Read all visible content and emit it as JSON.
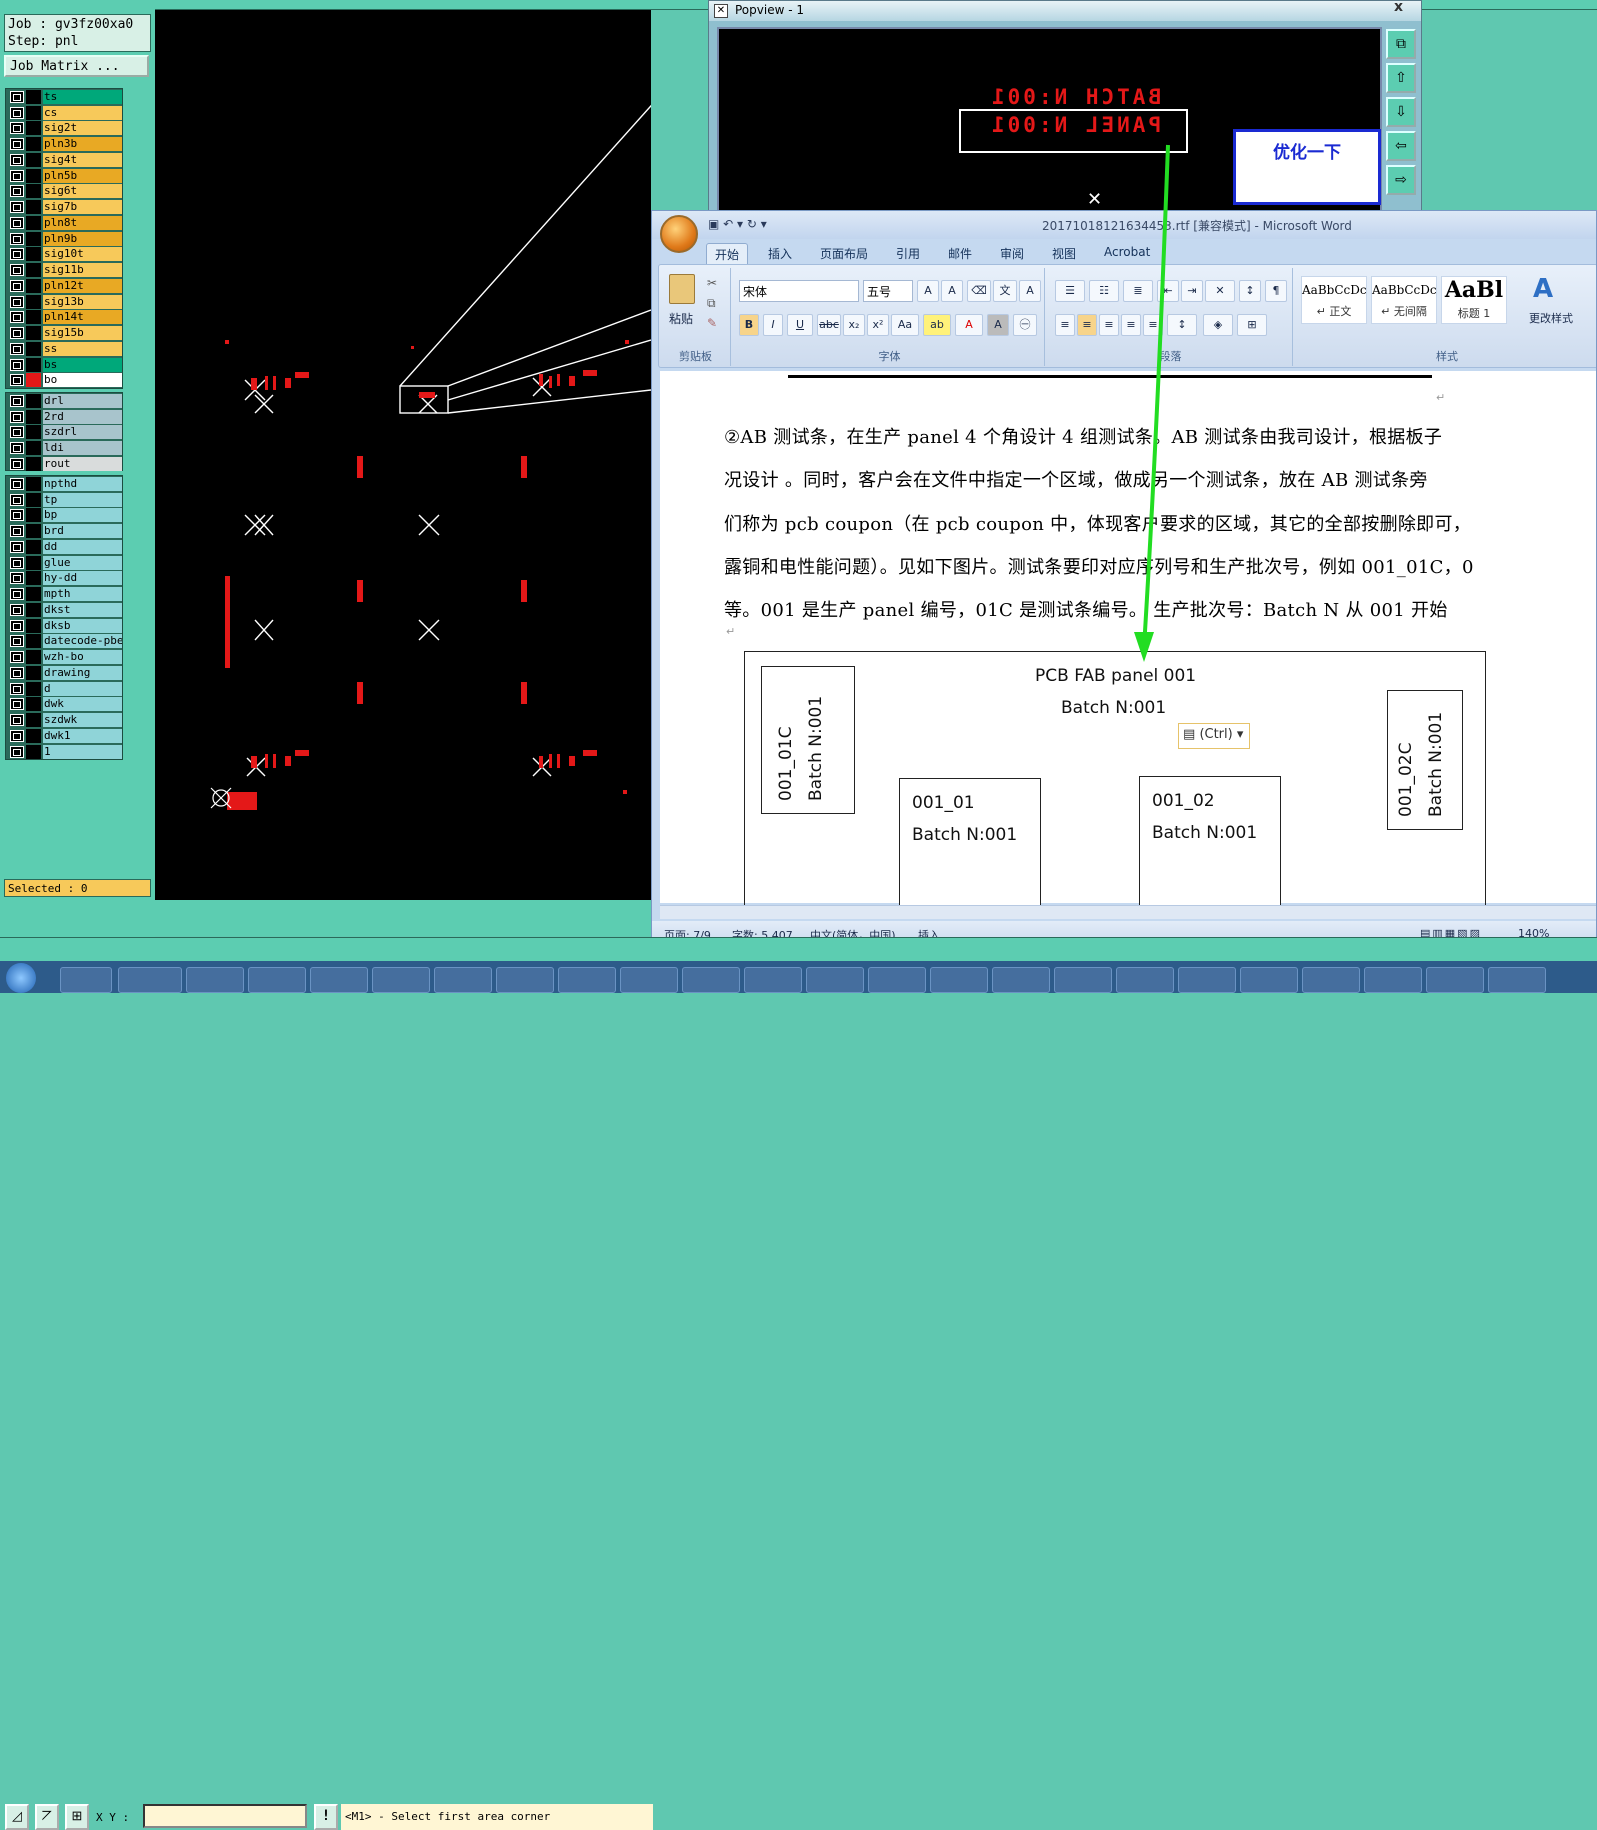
{
  "cam": {
    "job_line": "Job : gv3fz00xa0",
    "step_line": "Step: pnl",
    "job_matrix_button": "Job Matrix ...",
    "layers_group1": [
      {
        "name": "ts",
        "color": "#00a87a"
      },
      {
        "name": "cs",
        "color": "#f7c95a"
      },
      {
        "name": "sig2t",
        "color": "#f7c95a"
      },
      {
        "name": "pln3b",
        "color": "#e8a924"
      },
      {
        "name": "sig4t",
        "color": "#f7c95a"
      },
      {
        "name": "pln5b",
        "color": "#e8a924"
      },
      {
        "name": "sig6t",
        "color": "#f7c95a"
      },
      {
        "name": "sig7b",
        "color": "#f7c95a"
      },
      {
        "name": "pln8t",
        "color": "#e8a924"
      },
      {
        "name": "pln9b",
        "color": "#e8a924"
      },
      {
        "name": "sig10t",
        "color": "#f7c95a"
      },
      {
        "name": "sig11b",
        "color": "#f7c95a"
      },
      {
        "name": "pln12t",
        "color": "#e8a924"
      },
      {
        "name": "sig13b",
        "color": "#f7c95a"
      },
      {
        "name": "pln14t",
        "color": "#e8a924"
      },
      {
        "name": "sig15b",
        "color": "#f7c95a"
      },
      {
        "name": "ss",
        "color": "#f7c95a"
      },
      {
        "name": "bs",
        "color": "#00a87a"
      },
      {
        "name": "bo",
        "color": "#ffffff"
      }
    ],
    "layers_group2": [
      {
        "name": "drl",
        "color": "#a8c4cc"
      },
      {
        "name": "2rd",
        "color": "#a8c4cc"
      },
      {
        "name": "szdrl",
        "color": "#a8c4cc"
      },
      {
        "name": "ldi",
        "color": "#a8c4cc"
      },
      {
        "name": "rout",
        "color": "#d9dcdc"
      }
    ],
    "layers_group3": [
      {
        "name": "npthd",
        "color": "#8fd4d8"
      },
      {
        "name": "tp",
        "color": "#8fd4d8"
      },
      {
        "name": "bp",
        "color": "#8fd4d8"
      },
      {
        "name": "brd",
        "color": "#8fd4d8"
      },
      {
        "name": "dd",
        "color": "#8fd4d8"
      },
      {
        "name": "glue",
        "color": "#8fd4d8"
      },
      {
        "name": "hy-dd",
        "color": "#8fd4d8"
      },
      {
        "name": "mpth",
        "color": "#8fd4d8"
      },
      {
        "name": "dkst",
        "color": "#8fd4d8"
      },
      {
        "name": "dksb",
        "color": "#8fd4d8"
      },
      {
        "name": "datecode-pbe",
        "color": "#8fd4d8"
      },
      {
        "name": "wzh-bo",
        "color": "#8fd4d8"
      },
      {
        "name": "drawing",
        "color": "#8fd4d8"
      },
      {
        "name": "d",
        "color": "#8fd4d8"
      },
      {
        "name": "dwk",
        "color": "#8fd4d8"
      },
      {
        "name": "szdwk",
        "color": "#8fd4d8"
      },
      {
        "name": "dwk1",
        "color": "#8fd4d8"
      },
      {
        "name": "1",
        "color": "#8fd4d8"
      }
    ],
    "selected": "Selected : 0",
    "xy_label": "X Y :",
    "message": "<M1> - Select first area corner"
  },
  "popview": {
    "title": "Popview - 1",
    "close": "x",
    "mirror_line1": "BATCH N:001",
    "mirror_line2": "PANEL N:001",
    "note": "优化一下"
  },
  "word": {
    "title": "20171018121634453.rtf [兼容模式] - Microsoft Word",
    "tabs": [
      "开始",
      "插入",
      "页面布局",
      "引用",
      "邮件",
      "审阅",
      "视图",
      "Acrobat"
    ],
    "groups": {
      "clipboard": "剪贴板",
      "font": "字体",
      "paragraph": "段落",
      "styles": "样式"
    },
    "paste_label": "粘贴",
    "font_name": "宋体",
    "font_size": "五号",
    "styles": [
      {
        "sample": "AaBbCcDc",
        "name": "↵ 正文"
      },
      {
        "sample": "AaBbCcDc",
        "name": "↵ 无间隔"
      },
      {
        "sample": "AaBl",
        "name": "标题 1"
      }
    ],
    "change_styles": "更改样式",
    "paragraph_lines": [
      "②AB 测试条，在生产 panel   4 个角设计 4 组测试条。AB 测试条由我司设计，根据板子",
      "况设计 。同时，客户会在文件中指定一个区域，做成另一个测试条，放在 AB  测试条旁",
      "们称为 pcb coupon（在 pcb coupon 中，体现客户要求的区域，其它的全部按删除即可，",
      "露铜和电性能问题）。见如下图片。测试条要印对应序列号和生产批次号，例如 001_01C，0",
      "等。001 是生产 panel  编号，01C  是测试条编号。      生产批次号：Batch N 从 001 开始"
    ],
    "figure": {
      "header": "PCB FAB panel 001",
      "batch": "Batch N:001",
      "left_coupon_code": "001_01C",
      "left_coupon_batch": "Batch N:001",
      "right_coupon_code": "001_02C",
      "right_coupon_batch": "Batch N:001",
      "box1_code": "001_01",
      "box1_batch": "Batch N:001",
      "box2_code": "001_02",
      "box2_batch": "Batch N:001",
      "ctrl_tag": "(Ctrl)"
    },
    "status": {
      "page": "页面: 7/9",
      "words": "字数: 5,407",
      "language": "中文(简体，中国)",
      "mode": "插入",
      "zoom": "140%"
    }
  }
}
